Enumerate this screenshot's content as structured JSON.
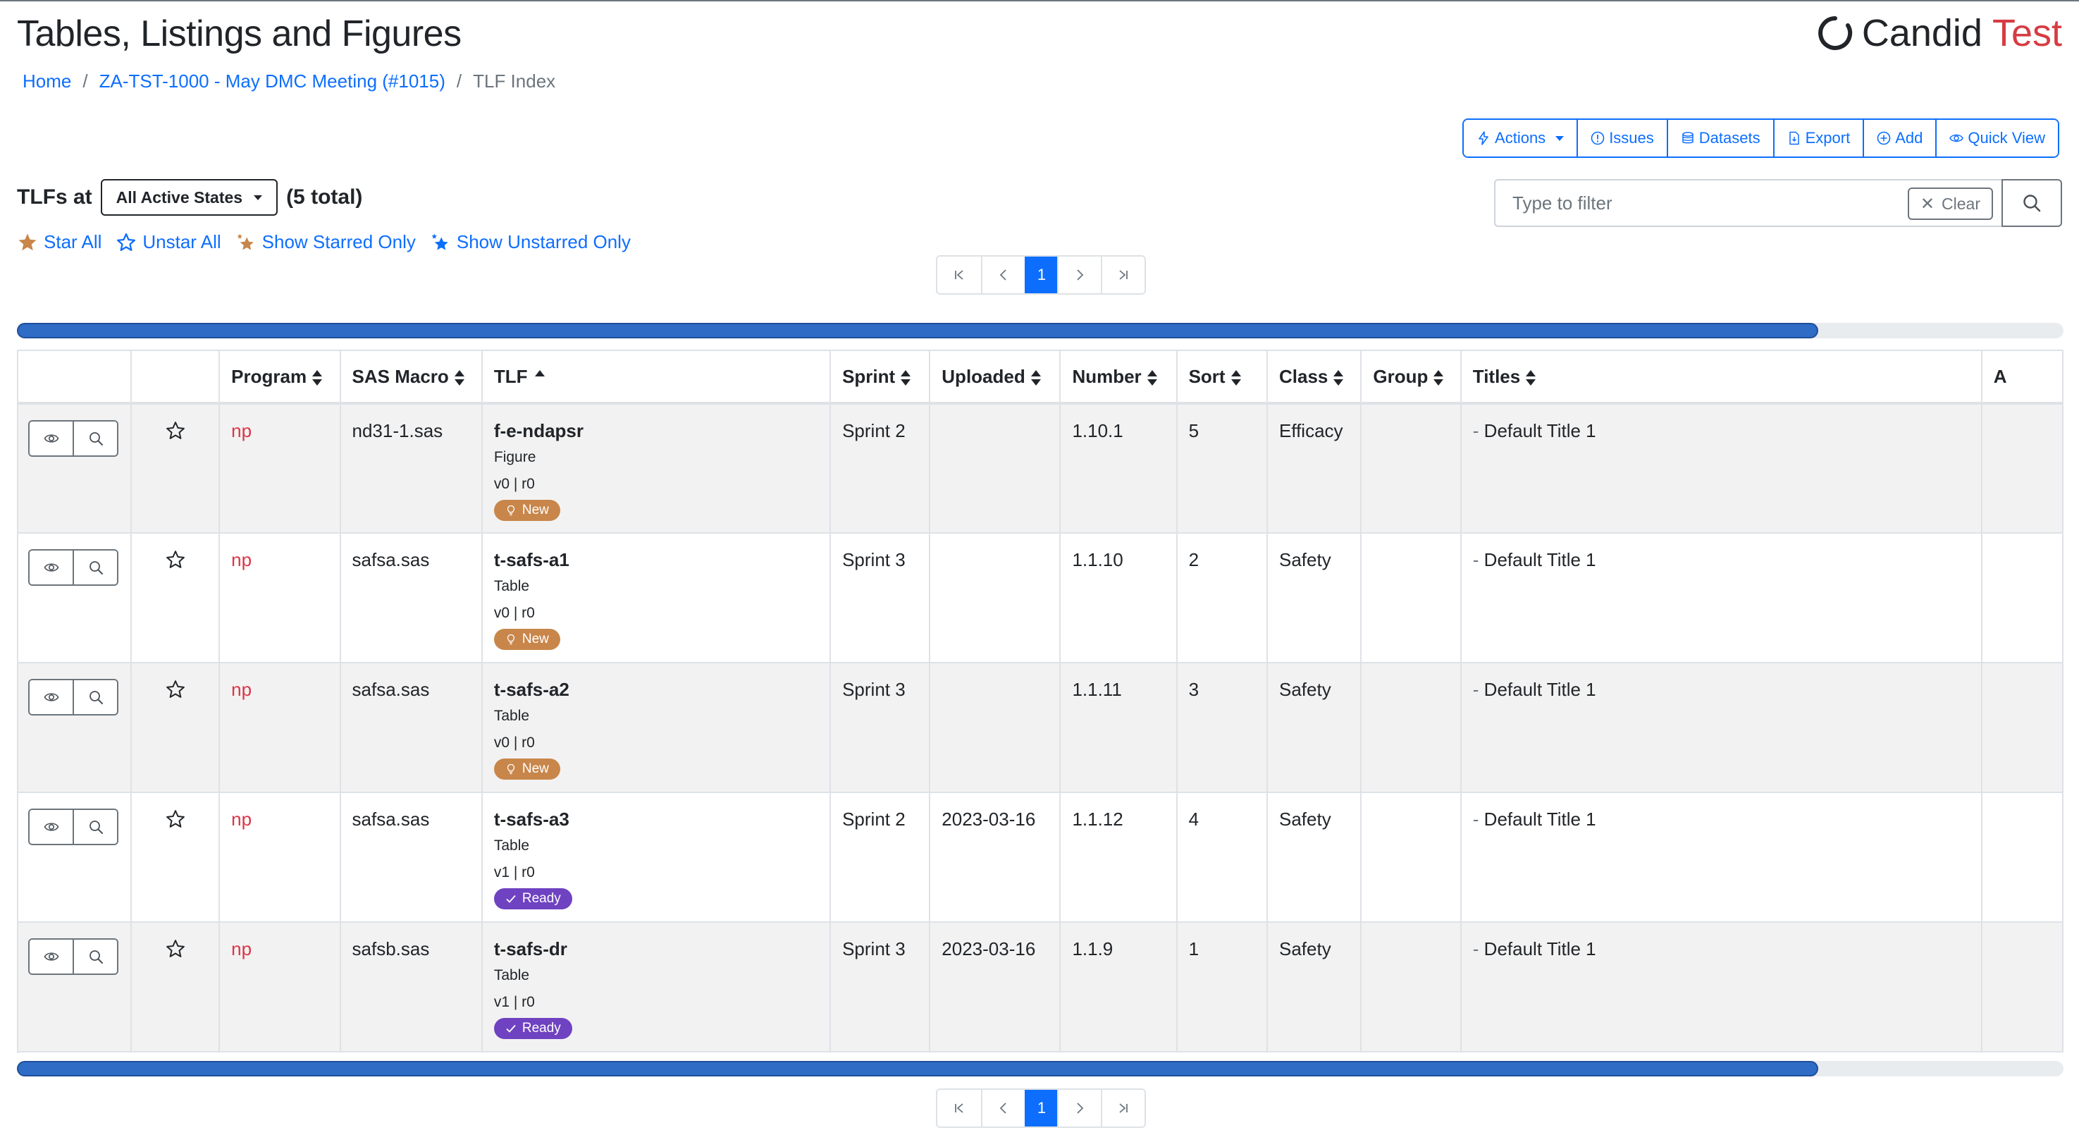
{
  "page": {
    "title": "Tables, Listings and Figures",
    "brand": {
      "name": "Candid",
      "env": "Test"
    }
  },
  "breadcrumb": {
    "home": "Home",
    "meeting": "ZA-TST-1000 - May DMC Meeting (#1015)",
    "sep": "/",
    "current": "TLF Index"
  },
  "toolbar": {
    "actions": "Actions",
    "issues": "Issues",
    "datasets": "Datasets",
    "export": "Export",
    "add": "Add",
    "quick_view": "Quick View"
  },
  "tlf_header": {
    "prefix": "TLFs at",
    "state": "All Active States",
    "total": "(5 total)"
  },
  "filter": {
    "placeholder": "Type to filter",
    "clear": "Clear"
  },
  "star_links": {
    "star_all": "Star All",
    "unstar_all": "Unstar All",
    "show_starred": "Show Starred Only",
    "show_unstarred": "Show Unstarred Only"
  },
  "pagination": {
    "current": "1"
  },
  "scroll": {
    "visible_fraction": 0.88
  },
  "colors": {
    "primary": "#0d6efd",
    "danger": "#dc3545",
    "badge_new": "#c8864a",
    "badge_ready": "#6f42c1",
    "brand_red": "#d63c43"
  },
  "table": {
    "columns": [
      "",
      "",
      "Program",
      "SAS Macro",
      "TLF",
      "Sprint",
      "Uploaded",
      "Number",
      "Sort",
      "Class",
      "Group",
      "Titles",
      "A"
    ],
    "rows": [
      {
        "program": "np",
        "macro": "nd31-1.sas",
        "tlf": "f-e-ndapsr",
        "type": "Figure",
        "version": "v0 | r0",
        "status": "New",
        "sprint": "Sprint 2",
        "uploaded": "",
        "number": "1.10.1",
        "sort": "5",
        "class": "Efficacy",
        "group": "",
        "title": "Default Title 1"
      },
      {
        "program": "np",
        "macro": "safsa.sas",
        "tlf": "t-safs-a1",
        "type": "Table",
        "version": "v0 | r0",
        "status": "New",
        "sprint": "Sprint 3",
        "uploaded": "",
        "number": "1.1.10",
        "sort": "2",
        "class": "Safety",
        "group": "",
        "title": "Default Title 1"
      },
      {
        "program": "np",
        "macro": "safsa.sas",
        "tlf": "t-safs-a2",
        "type": "Table",
        "version": "v0 | r0",
        "status": "New",
        "sprint": "Sprint 3",
        "uploaded": "",
        "number": "1.1.11",
        "sort": "3",
        "class": "Safety",
        "group": "",
        "title": "Default Title 1"
      },
      {
        "program": "np",
        "macro": "safsa.sas",
        "tlf": "t-safs-a3",
        "type": "Table",
        "version": "v1 | r0",
        "status": "Ready",
        "sprint": "Sprint 2",
        "uploaded": "2023-03-16",
        "number": "1.1.12",
        "sort": "4",
        "class": "Safety",
        "group": "",
        "title": "Default Title 1"
      },
      {
        "program": "np",
        "macro": "safsb.sas",
        "tlf": "t-safs-dr",
        "type": "Table",
        "version": "v1 | r0",
        "status": "Ready",
        "sprint": "Sprint 3",
        "uploaded": "2023-03-16",
        "number": "1.1.9",
        "sort": "1",
        "class": "Safety",
        "group": "",
        "title": "Default Title 1"
      }
    ]
  }
}
